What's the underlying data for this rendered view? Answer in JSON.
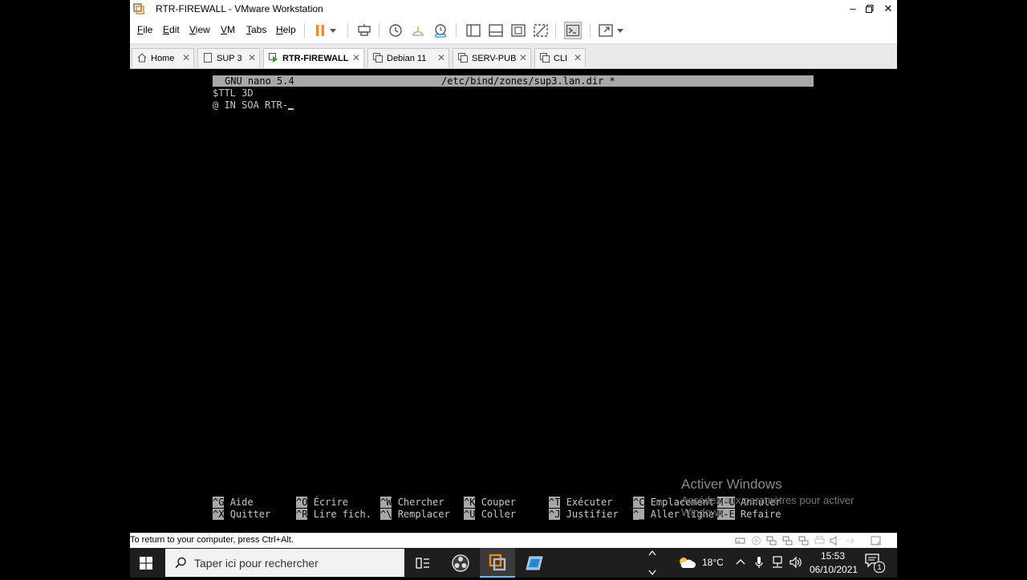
{
  "window": {
    "title": "RTR-FIREWALL - VMware Workstation"
  },
  "menu": [
    {
      "label": "File",
      "u": "F",
      "rest": "ile"
    },
    {
      "label": "Edit",
      "u": "E",
      "rest": "dit"
    },
    {
      "label": "View",
      "u": "V",
      "rest": "iew"
    },
    {
      "label": "VM",
      "u": "V",
      "rest": "M"
    },
    {
      "label": "Tabs",
      "u": "T",
      "rest": "abs"
    },
    {
      "label": "Help",
      "u": "H",
      "rest": "elp"
    }
  ],
  "tabs": [
    {
      "label": "Home",
      "icon": "home-icon"
    },
    {
      "label": "SUP 3",
      "icon": "vm-icon"
    },
    {
      "label": "RTR-FIREWALL",
      "icon": "vm-running-icon",
      "active": true
    },
    {
      "label": "Debian 11",
      "icon": "vm-icon"
    },
    {
      "label": "SERV-PUB",
      "icon": "vm-icon"
    },
    {
      "label": "CLI",
      "icon": "vm-icon"
    }
  ],
  "nano": {
    "version": "GNU nano 5.4",
    "file": "/etc/bind/zones/sup3.lan.dir *",
    "lines": [
      "$TTL 3D",
      "@ IN SOA RTR-"
    ],
    "shortcuts": [
      {
        "k1": "^G",
        "l1": "Aide",
        "k2": "^X",
        "l2": "Quitter"
      },
      {
        "k1": "^O",
        "l1": "Écrire",
        "k2": "^R",
        "l2": "Lire fich."
      },
      {
        "k1": "^W",
        "l1": "Chercher",
        "k2": "^\\",
        "l2": "Remplacer"
      },
      {
        "k1": "^K",
        "l1": "Couper",
        "k2": "^U",
        "l2": "Coller"
      },
      {
        "k1": "^T",
        "l1": "Exécuter",
        "k2": "^J",
        "l2": "Justifier"
      },
      {
        "k1": "^C",
        "l1": "Emplacement",
        "k2": "^_",
        "l2": "Aller ligne"
      },
      {
        "k1": "M-U",
        "l1": "Annuler",
        "k2": "M-E",
        "l2": "Refaire"
      }
    ]
  },
  "watermark": {
    "title": "Activer Windows",
    "subtitle": "Accédez aux paramètres pour activer Windows."
  },
  "status": {
    "message": "To return to your computer, press Ctrl+Alt."
  },
  "taskbar": {
    "search_placeholder": "Taper ici pour rechercher",
    "temperature": "18°C",
    "time": "15:53",
    "date": "06/10/2021",
    "notifications": "1"
  },
  "colors": {
    "console_bg": "#000000",
    "console_fg": "#c6c6c6",
    "nano_bar": "#a8a8a8",
    "pause_orange": "#f08c1e",
    "taskbar": "#1e1e1e"
  }
}
